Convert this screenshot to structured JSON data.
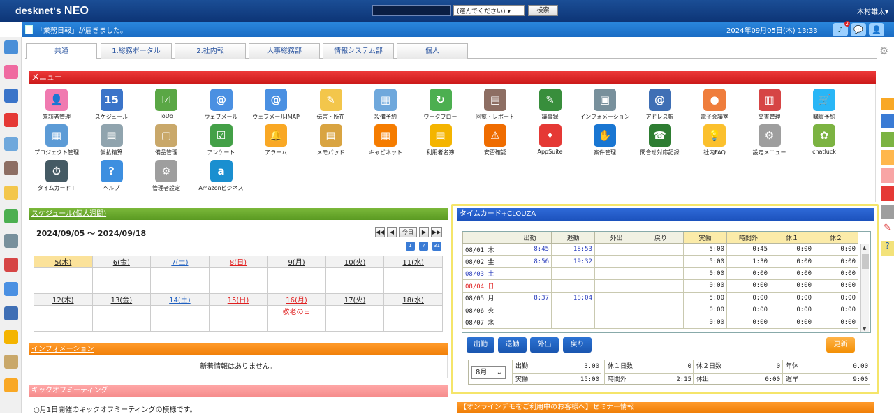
{
  "app": {
    "logo_prefix": "desknet's",
    "logo_name": "NEO"
  },
  "search": {
    "placeholder": "",
    "select": "(選んでください)",
    "button": "検索"
  },
  "user": {
    "name": "木村雄太▾"
  },
  "notice": {
    "text": "「業務日報」が届きました。",
    "datetime": "2024年09月05日(木) 13:33",
    "badge": "2"
  },
  "tabs": [
    "共通",
    "1.総務ポータル",
    "2.社内報",
    "人事総務部",
    "情報システム部",
    "個人"
  ],
  "menu": {
    "title": "メニュー",
    "items": [
      {
        "label": "来訪者管理",
        "color": "#f07ab0",
        "glyph": "👤"
      },
      {
        "label": "スケジュール",
        "color": "#3a74c9",
        "glyph": "15"
      },
      {
        "label": "ToDo",
        "color": "#5aa745",
        "glyph": "☑"
      },
      {
        "label": "ウェブメール",
        "color": "#4a90e2",
        "glyph": "@"
      },
      {
        "label": "ウェブメールIMAP",
        "color": "#4a90e2",
        "glyph": "@"
      },
      {
        "label": "伝言・所在",
        "color": "#f3c64b",
        "glyph": "✎"
      },
      {
        "label": "設備予約",
        "color": "#6fa8dc",
        "glyph": "▦"
      },
      {
        "label": "ワークフロー",
        "color": "#4caf50",
        "glyph": "↻"
      },
      {
        "label": "回覧・レポート",
        "color": "#8d6e63",
        "glyph": "▤"
      },
      {
        "label": "議事録",
        "color": "#388e3c",
        "glyph": "✎"
      },
      {
        "label": "インフォメーション",
        "color": "#78909c",
        "glyph": "▣"
      },
      {
        "label": "アドレス帳",
        "color": "#3f6fb5",
        "glyph": "@"
      },
      {
        "label": "電子会議室",
        "color": "#ef7d3c",
        "glyph": "●"
      },
      {
        "label": "文書管理",
        "color": "#d64545",
        "glyph": "▥"
      },
      {
        "label": "購買予約",
        "color": "#29b6f6",
        "glyph": "🛒"
      },
      {
        "label": "プロジェクト管理",
        "color": "#5c9bd6",
        "glyph": "▦"
      },
      {
        "label": "仮払精算",
        "color": "#90a4ae",
        "glyph": "▤"
      },
      {
        "label": "備品管理",
        "color": "#c9a86a",
        "glyph": "▢"
      },
      {
        "label": "アンケート",
        "color": "#43a047",
        "glyph": "☑"
      },
      {
        "label": "アラーム",
        "color": "#f9a825",
        "glyph": "🔔"
      },
      {
        "label": "メモパッド",
        "color": "#d9a441",
        "glyph": "▤"
      },
      {
        "label": "キャビネット",
        "color": "#f57c00",
        "glyph": "▦"
      },
      {
        "label": "利用者名簿",
        "color": "#f4b400",
        "glyph": "▤"
      },
      {
        "label": "安否確認",
        "color": "#ef6c00",
        "glyph": "⚠"
      },
      {
        "label": "AppSuite",
        "color": "#e53935",
        "glyph": "✦"
      },
      {
        "label": "案件管理",
        "color": "#1976d2",
        "glyph": "✋"
      },
      {
        "label": "問合せ対応記録",
        "color": "#2e7d32",
        "glyph": "☎"
      },
      {
        "label": "社内FAQ",
        "color": "#fbc02d",
        "glyph": "💡"
      },
      {
        "label": "設定メニュー",
        "color": "#9e9e9e",
        "glyph": "⚙"
      },
      {
        "label": "chatluck",
        "color": "#7cb342",
        "glyph": "✿"
      },
      {
        "label": "タイムカード+",
        "color": "#455a64",
        "glyph": "⏱"
      },
      {
        "label": "ヘルプ",
        "color": "#3d8fe0",
        "glyph": "?"
      },
      {
        "label": "管理者設定",
        "color": "#9e9e9e",
        "glyph": "⚙"
      },
      {
        "label": "Amazonビジネス",
        "color": "#1a8fd0",
        "glyph": "a"
      }
    ]
  },
  "schedule": {
    "title": "スケジュール(個人週間)",
    "range": "2024/09/05 ～ 2024/09/18",
    "today": "今日",
    "cal_icons": [
      "1",
      "7",
      "31"
    ],
    "week1": [
      {
        "d": "5(木)",
        "c": "#222",
        "bg": "#fbe29a"
      },
      {
        "d": "6(金)",
        "c": "#222"
      },
      {
        "d": "7(土)",
        "c": "#2060c0"
      },
      {
        "d": "8(日)",
        "c": "#e02020"
      },
      {
        "d": "9(月)",
        "c": "#222"
      },
      {
        "d": "10(火)",
        "c": "#222"
      },
      {
        "d": "11(水)",
        "c": "#222"
      }
    ],
    "week2": [
      {
        "d": "12(木)",
        "c": "#222"
      },
      {
        "d": "13(金)",
        "c": "#222"
      },
      {
        "d": "14(土)",
        "c": "#2060c0"
      },
      {
        "d": "15(日)",
        "c": "#e02020"
      },
      {
        "d": "16(月)",
        "c": "#e02020"
      },
      {
        "d": "17(火)",
        "c": "#222"
      },
      {
        "d": "18(水)",
        "c": "#222"
      }
    ],
    "holiday": "敬老の日"
  },
  "info": {
    "title": "インフォメーション",
    "empty": "新着情報はありません。"
  },
  "kickoff": {
    "title": "キックオフミーティング",
    "text": "○月1日開催のキックオフミーティングの模様です。"
  },
  "timecard": {
    "title": "タイムカード+CLOUZA",
    "columns": [
      "",
      "出勤",
      "退勤",
      "外出",
      "戻り",
      "実働",
      "時間外",
      "休１",
      "休２"
    ],
    "rows": [
      {
        "date": "08/01 木",
        "in": "8:45",
        "out": "18:53",
        "w": "5:00",
        "ot": "0:45",
        "b1": "0:00",
        "b2": "0:00",
        "c": "#222"
      },
      {
        "date": "08/02 金",
        "in": "8:56",
        "out": "19:32",
        "w": "5:00",
        "ot": "1:30",
        "b1": "0:00",
        "b2": "0:00",
        "c": "#222"
      },
      {
        "date": "08/03 土",
        "in": "",
        "out": "",
        "w": "0:00",
        "ot": "0:00",
        "b1": "0:00",
        "b2": "0:00",
        "c": "#2b3fbd"
      },
      {
        "date": "08/04 日",
        "in": "",
        "out": "",
        "w": "0:00",
        "ot": "0:00",
        "b1": "0:00",
        "b2": "0:00",
        "c": "#e02020"
      },
      {
        "date": "08/05 月",
        "in": "8:37",
        "out": "18:04",
        "w": "5:00",
        "ot": "0:00",
        "b1": "0:00",
        "b2": "0:00",
        "c": "#222"
      },
      {
        "date": "08/06 火",
        "in": "",
        "out": "",
        "w": "0:00",
        "ot": "0:00",
        "b1": "0:00",
        "b2": "0:00",
        "c": "#222"
      },
      {
        "date": "08/07 水",
        "in": "",
        "out": "",
        "w": "0:00",
        "ot": "0:00",
        "b1": "0:00",
        "b2": "0:00",
        "c": "#222"
      }
    ],
    "buttons": {
      "in": "出勤",
      "out": "退勤",
      "go": "外出",
      "back": "戻り",
      "refresh": "更新"
    },
    "month": "8月",
    "summary": [
      {
        "label": "出勤",
        "value": "3.00"
      },
      {
        "label": "休１日数",
        "value": "0"
      },
      {
        "label": "休２日数",
        "value": "0"
      },
      {
        "label": "年休",
        "value": "0.00"
      },
      {
        "label": "実働",
        "value": "15:00"
      },
      {
        "label": "時間外",
        "value": "2:15"
      },
      {
        "label": "休出",
        "value": "0:00"
      },
      {
        "label": "遅早",
        "value": "9:00"
      }
    ]
  },
  "seminar": {
    "title": "【オンラインデモをご利用中のお客様へ】セミナー情報"
  }
}
